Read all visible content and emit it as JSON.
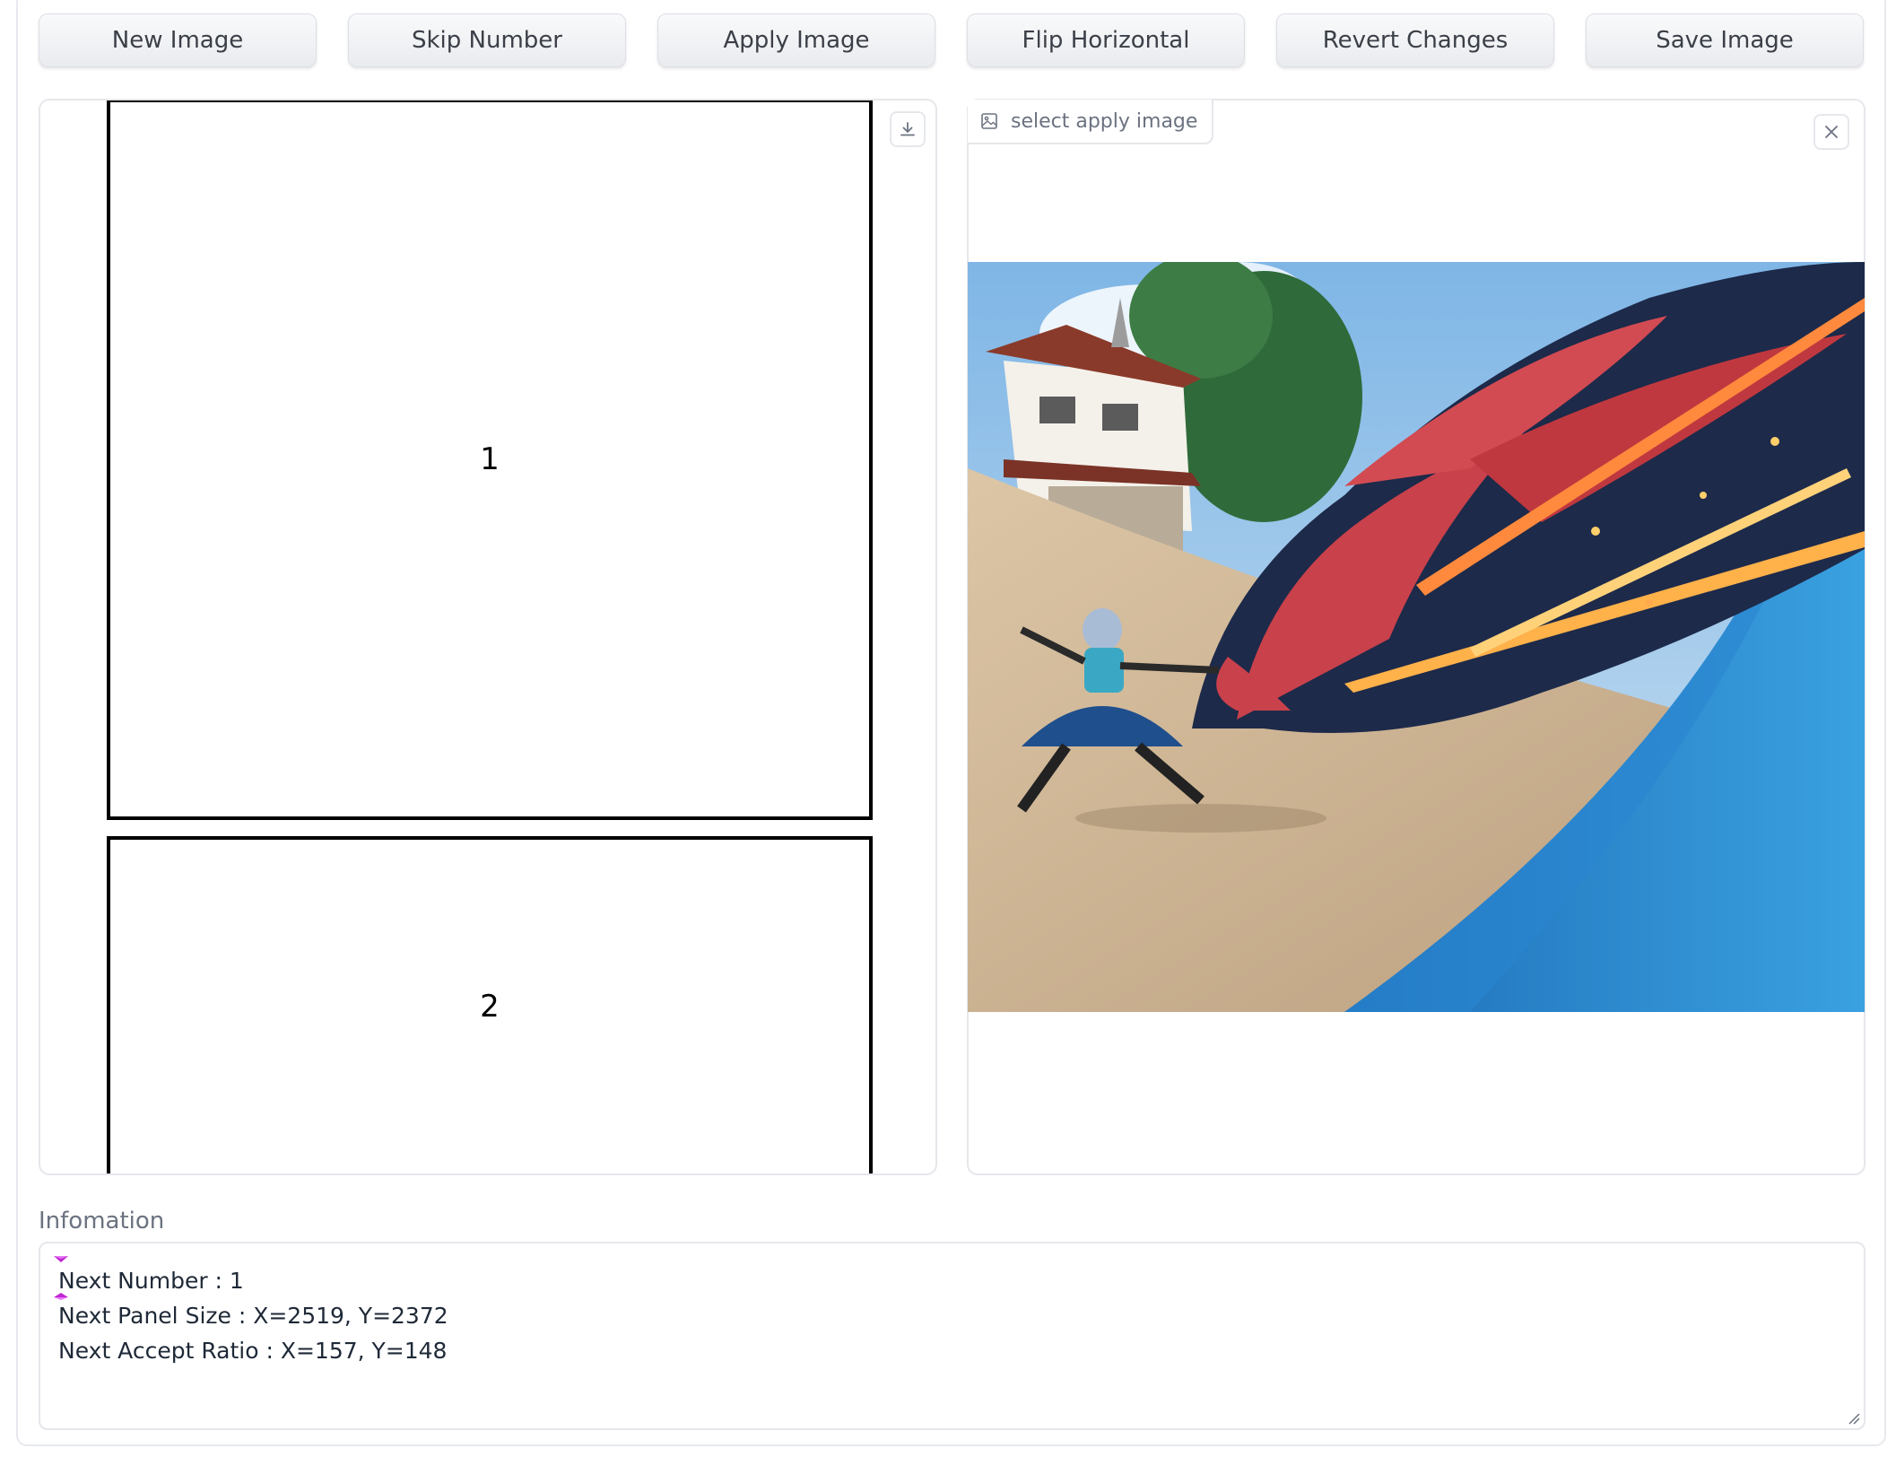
{
  "toolbar": {
    "buttons": [
      "New Image",
      "Skip Number",
      "Apply Image",
      "Flip Horizontal",
      "Revert Changes",
      "Save Image"
    ]
  },
  "canvas": {
    "panels": [
      "1",
      "2"
    ],
    "download_icon": "download-icon"
  },
  "apply_image": {
    "label": "select apply image",
    "label_icon": "image-icon",
    "close_icon": "close-icon",
    "image_description_icon": "anime-illustration"
  },
  "info": {
    "label": "Infomation",
    "lines": [
      "Next Number : 1",
      "Next Panel Size : X=2519, Y=2372",
      "Next Accept Ratio : X=157, Y=148"
    ]
  },
  "colors": {
    "accent_marker": "#c026d3",
    "panel_border": "#000000"
  }
}
